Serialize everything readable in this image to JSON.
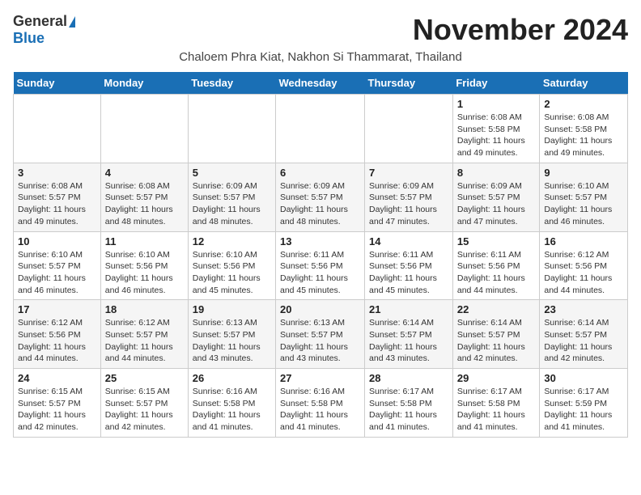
{
  "header": {
    "logo_general": "General",
    "logo_blue": "Blue",
    "month_title": "November 2024",
    "subtitle": "Chaloem Phra Kiat, Nakhon Si Thammarat, Thailand"
  },
  "days_of_week": [
    "Sunday",
    "Monday",
    "Tuesday",
    "Wednesday",
    "Thursday",
    "Friday",
    "Saturday"
  ],
  "weeks": [
    [
      {
        "num": "",
        "info": ""
      },
      {
        "num": "",
        "info": ""
      },
      {
        "num": "",
        "info": ""
      },
      {
        "num": "",
        "info": ""
      },
      {
        "num": "",
        "info": ""
      },
      {
        "num": "1",
        "info": "Sunrise: 6:08 AM\nSunset: 5:58 PM\nDaylight: 11 hours and 49 minutes."
      },
      {
        "num": "2",
        "info": "Sunrise: 6:08 AM\nSunset: 5:58 PM\nDaylight: 11 hours and 49 minutes."
      }
    ],
    [
      {
        "num": "3",
        "info": "Sunrise: 6:08 AM\nSunset: 5:57 PM\nDaylight: 11 hours and 49 minutes."
      },
      {
        "num": "4",
        "info": "Sunrise: 6:08 AM\nSunset: 5:57 PM\nDaylight: 11 hours and 48 minutes."
      },
      {
        "num": "5",
        "info": "Sunrise: 6:09 AM\nSunset: 5:57 PM\nDaylight: 11 hours and 48 minutes."
      },
      {
        "num": "6",
        "info": "Sunrise: 6:09 AM\nSunset: 5:57 PM\nDaylight: 11 hours and 48 minutes."
      },
      {
        "num": "7",
        "info": "Sunrise: 6:09 AM\nSunset: 5:57 PM\nDaylight: 11 hours and 47 minutes."
      },
      {
        "num": "8",
        "info": "Sunrise: 6:09 AM\nSunset: 5:57 PM\nDaylight: 11 hours and 47 minutes."
      },
      {
        "num": "9",
        "info": "Sunrise: 6:10 AM\nSunset: 5:57 PM\nDaylight: 11 hours and 46 minutes."
      }
    ],
    [
      {
        "num": "10",
        "info": "Sunrise: 6:10 AM\nSunset: 5:57 PM\nDaylight: 11 hours and 46 minutes."
      },
      {
        "num": "11",
        "info": "Sunrise: 6:10 AM\nSunset: 5:56 PM\nDaylight: 11 hours and 46 minutes."
      },
      {
        "num": "12",
        "info": "Sunrise: 6:10 AM\nSunset: 5:56 PM\nDaylight: 11 hours and 45 minutes."
      },
      {
        "num": "13",
        "info": "Sunrise: 6:11 AM\nSunset: 5:56 PM\nDaylight: 11 hours and 45 minutes."
      },
      {
        "num": "14",
        "info": "Sunrise: 6:11 AM\nSunset: 5:56 PM\nDaylight: 11 hours and 45 minutes."
      },
      {
        "num": "15",
        "info": "Sunrise: 6:11 AM\nSunset: 5:56 PM\nDaylight: 11 hours and 44 minutes."
      },
      {
        "num": "16",
        "info": "Sunrise: 6:12 AM\nSunset: 5:56 PM\nDaylight: 11 hours and 44 minutes."
      }
    ],
    [
      {
        "num": "17",
        "info": "Sunrise: 6:12 AM\nSunset: 5:56 PM\nDaylight: 11 hours and 44 minutes."
      },
      {
        "num": "18",
        "info": "Sunrise: 6:12 AM\nSunset: 5:57 PM\nDaylight: 11 hours and 44 minutes."
      },
      {
        "num": "19",
        "info": "Sunrise: 6:13 AM\nSunset: 5:57 PM\nDaylight: 11 hours and 43 minutes."
      },
      {
        "num": "20",
        "info": "Sunrise: 6:13 AM\nSunset: 5:57 PM\nDaylight: 11 hours and 43 minutes."
      },
      {
        "num": "21",
        "info": "Sunrise: 6:14 AM\nSunset: 5:57 PM\nDaylight: 11 hours and 43 minutes."
      },
      {
        "num": "22",
        "info": "Sunrise: 6:14 AM\nSunset: 5:57 PM\nDaylight: 11 hours and 42 minutes."
      },
      {
        "num": "23",
        "info": "Sunrise: 6:14 AM\nSunset: 5:57 PM\nDaylight: 11 hours and 42 minutes."
      }
    ],
    [
      {
        "num": "24",
        "info": "Sunrise: 6:15 AM\nSunset: 5:57 PM\nDaylight: 11 hours and 42 minutes."
      },
      {
        "num": "25",
        "info": "Sunrise: 6:15 AM\nSunset: 5:57 PM\nDaylight: 11 hours and 42 minutes."
      },
      {
        "num": "26",
        "info": "Sunrise: 6:16 AM\nSunset: 5:58 PM\nDaylight: 11 hours and 41 minutes."
      },
      {
        "num": "27",
        "info": "Sunrise: 6:16 AM\nSunset: 5:58 PM\nDaylight: 11 hours and 41 minutes."
      },
      {
        "num": "28",
        "info": "Sunrise: 6:17 AM\nSunset: 5:58 PM\nDaylight: 11 hours and 41 minutes."
      },
      {
        "num": "29",
        "info": "Sunrise: 6:17 AM\nSunset: 5:58 PM\nDaylight: 11 hours and 41 minutes."
      },
      {
        "num": "30",
        "info": "Sunrise: 6:17 AM\nSunset: 5:59 PM\nDaylight: 11 hours and 41 minutes."
      }
    ]
  ]
}
